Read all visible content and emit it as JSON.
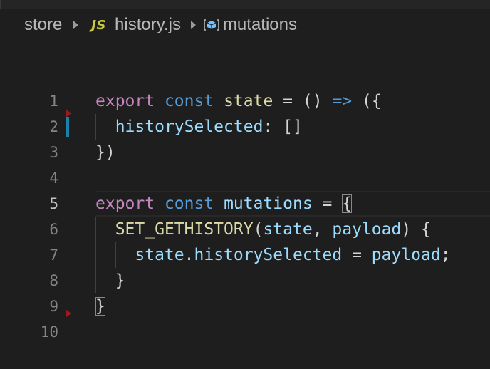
{
  "breadcrumb": {
    "folder": "store",
    "file_icon": "JS",
    "file": "history.js",
    "symbol_icon": "symbol-field-icon",
    "symbol": "mutations"
  },
  "editor": {
    "language": "javascript",
    "current_line": 5,
    "lines": [
      {
        "number": "1",
        "text": "export const state = () => ({"
      },
      {
        "number": "2",
        "text": "  historySelected: []"
      },
      {
        "number": "3",
        "text": "})"
      },
      {
        "number": "4",
        "text": ""
      },
      {
        "number": "5",
        "text": "export const mutations = {"
      },
      {
        "number": "6",
        "text": "  SET_GETHISTORY(state, payload) {"
      },
      {
        "number": "7",
        "text": "    state.historySelected = payload;"
      },
      {
        "number": "8",
        "text": "  }"
      },
      {
        "number": "9",
        "text": "}"
      },
      {
        "number": "10",
        "text": ""
      }
    ]
  },
  "colors": {
    "background": "#1e1e1e",
    "keyword": "#c586c0",
    "storage": "#569cd6",
    "function": "#dcdcaa",
    "variable": "#9cdcfe",
    "line_number": "#858585",
    "modified_gutter": "#1b81a8",
    "gutter_marker": "#9e1a1a"
  }
}
